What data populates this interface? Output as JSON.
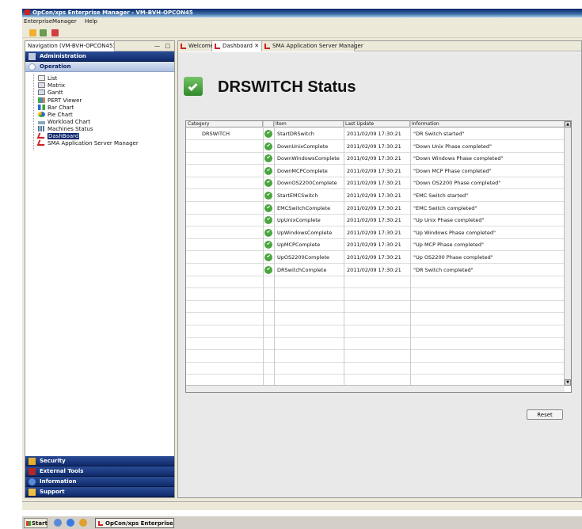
{
  "window": {
    "title": "OpCon/xps Enterprise Manager - VM-BVH-OPCON45"
  },
  "menu": {
    "items": [
      "EnterpriseManager",
      "Help"
    ]
  },
  "navigation": {
    "tab_label": "Navigation (VM-BVH-OPCON45)",
    "minmax": "— □",
    "administration": "Administration",
    "operation": "Operation",
    "tree": [
      "List",
      "Matrix",
      "Gantt",
      "PERT Viewer",
      "Bar Chart",
      "Pie Chart",
      "Workload Chart",
      "Machines Status",
      "DashBoard",
      "SMA Application Server Manager"
    ],
    "selected_index": 8,
    "bottom": [
      "Security",
      "External Tools",
      "Information",
      "Support"
    ]
  },
  "editor_tabs": [
    {
      "label": "Welcome"
    },
    {
      "label": "Dashboard",
      "close": "✕"
    },
    {
      "label": "SMA Application Server Manager"
    }
  ],
  "dashboard": {
    "title": "DRSWITCH Status",
    "columns": [
      "Category",
      "Item",
      "Last Update",
      "Information"
    ],
    "category": "DRSWITCH",
    "rows": [
      {
        "item": "StartDRSwitch",
        "last_update": "2011/02/09 17:30:21",
        "information": "\"DR Switch started\""
      },
      {
        "item": "DownUnixComplete",
        "last_update": "2011/02/09 17:30:21",
        "information": "\"Down Unix Phase completed\""
      },
      {
        "item": "DownWindowsComplete",
        "last_update": "2011/02/09 17:30:21",
        "information": "\"Down Windows Phase completed\""
      },
      {
        "item": "DownMCPComplete",
        "last_update": "2011/02/09 17:30:21",
        "information": "\"Down MCP Phase completed\""
      },
      {
        "item": "DownOS2200Complete",
        "last_update": "2011/02/09 17:30:21",
        "information": "\"Down OS2200 Phase completed\""
      },
      {
        "item": "StartEMCSwitch",
        "last_update": "2011/02/09 17:30:21",
        "information": "\"EMC Switch started\""
      },
      {
        "item": "EMCSwitchComplete",
        "last_update": "2011/02/09 17:30:21",
        "information": "\"EMC Switch completed\""
      },
      {
        "item": "UpUnixComplete",
        "last_update": "2011/02/09 17:30:21",
        "information": "\"Up Unix Phase completed\""
      },
      {
        "item": "UpWindowsComplete",
        "last_update": "2011/02/09 17:30:21",
        "information": "\"Up Windows Phase completed\""
      },
      {
        "item": "UpMCPComplete",
        "last_update": "2011/02/09 17:30:21",
        "information": "\"Up MCP Phase completed\""
      },
      {
        "item": "UpOS2200Complete",
        "last_update": "2011/02/09 17:30:21",
        "information": "\"Up OS2200 Phase completed\""
      },
      {
        "item": "DRSwitchComplete",
        "last_update": "2011/02/09 17:30:21",
        "information": "\"DR Switch completed\""
      }
    ],
    "reset_label": "Reset"
  },
  "taskbar": {
    "start_label": "Start",
    "task_label": "OpCon/xps Enterprise..."
  },
  "colors": {
    "nav_bar": "#0f2a6b",
    "status_ok": "#4aa63f",
    "accent_red": "#cc2222"
  }
}
